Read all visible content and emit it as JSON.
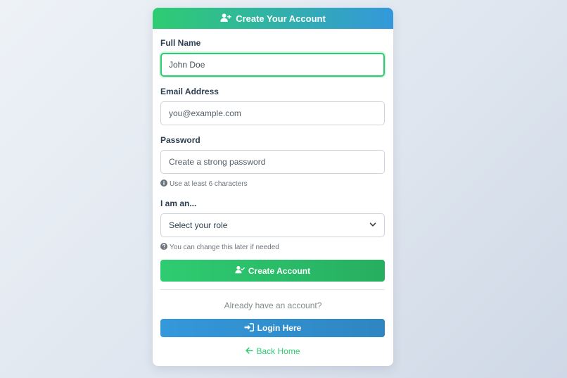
{
  "header": {
    "title": "Create Your Account",
    "icon": "user-plus-icon"
  },
  "form": {
    "full_name": {
      "label": "Full Name",
      "value": "John Doe",
      "placeholder": ""
    },
    "email": {
      "label": "Email Address",
      "value": "",
      "placeholder": "you@example.com"
    },
    "password": {
      "label": "Password",
      "value": "",
      "placeholder": "Create a strong password",
      "hint": "Use at least 6 characters",
      "hint_icon": "info-circle-icon"
    },
    "role": {
      "label": "I am an...",
      "selected": "Select your role",
      "hint": "You can change this later if needed",
      "hint_icon": "question-circle-icon"
    },
    "submit_label": "Create Account",
    "submit_icon": "user-check-icon"
  },
  "login": {
    "prompt": "Already have an account?",
    "button_label": "Login Here",
    "button_icon": "sign-in-icon"
  },
  "back": {
    "label": "Back Home",
    "icon": "arrow-left-icon"
  },
  "colors": {
    "primary_green": "#2ecc71",
    "primary_blue": "#3498db",
    "text_dark": "#2c3e50",
    "muted": "#7f8c8d"
  }
}
